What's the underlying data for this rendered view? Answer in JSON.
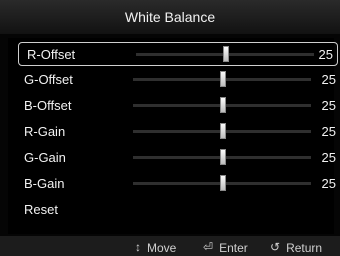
{
  "title": "White Balance",
  "rows": [
    {
      "label": "R-Offset",
      "value": "25",
      "level": 0.5,
      "selected": true
    },
    {
      "label": "G-Offset",
      "value": "25",
      "level": 0.5
    },
    {
      "label": "B-Offset",
      "value": "25",
      "level": 0.5
    },
    {
      "label": "R-Gain",
      "value": "25",
      "level": 0.5
    },
    {
      "label": "G-Gain",
      "value": "25",
      "level": 0.5
    },
    {
      "label": "B-Gain",
      "value": "25",
      "level": 0.5
    },
    {
      "label": "Reset"
    }
  ],
  "footer": {
    "move": {
      "icon": "up-down-arrows-icon",
      "label": "Move"
    },
    "enter": {
      "icon": "enter-icon",
      "label": "Enter"
    },
    "return": {
      "icon": "return-icon",
      "label": "Return"
    }
  }
}
